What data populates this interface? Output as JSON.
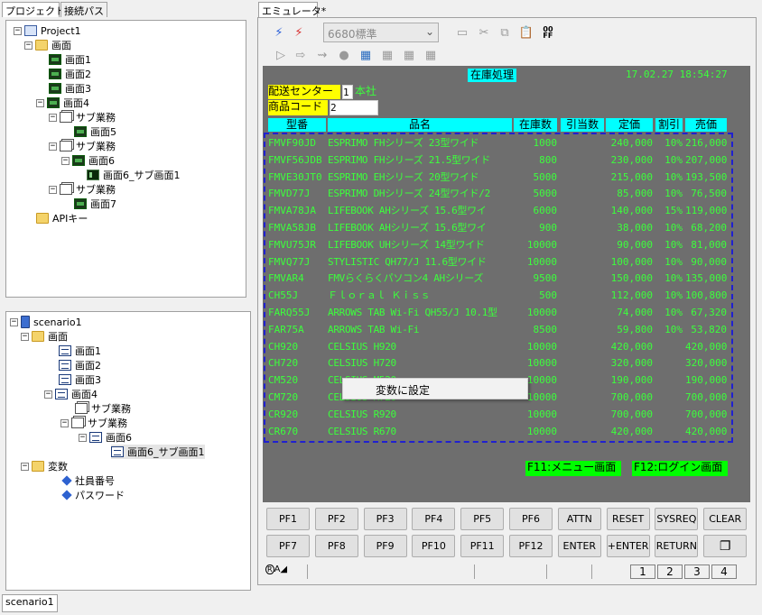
{
  "left_tabs": [
    "プロジェクト",
    "接続パス"
  ],
  "project_tree": [
    {
      "label": "Project1",
      "icon": "project-icon",
      "exp": "−"
    },
    {
      "label": "画面",
      "icon": "folder-icon",
      "exp": "−"
    },
    {
      "label": "画面1",
      "icon": "screen-icon",
      "exp": ""
    },
    {
      "label": "画面2",
      "icon": "screen-icon",
      "exp": ""
    },
    {
      "label": "画面3",
      "icon": "screen-icon",
      "exp": ""
    },
    {
      "label": "画面4",
      "icon": "screen-icon",
      "exp": "−"
    },
    {
      "label": "サブ業務",
      "icon": "sub-business-icon",
      "exp": "−"
    },
    {
      "label": "画面5",
      "icon": "screen-icon",
      "exp": ""
    },
    {
      "label": "サブ業務",
      "icon": "sub-business-icon",
      "exp": "−"
    },
    {
      "label": "画面6",
      "icon": "screen-icon",
      "exp": "−"
    },
    {
      "label": "画面6_サブ画面1",
      "icon": "sub-screen-icon",
      "exp": ""
    },
    {
      "label": "サブ業務",
      "icon": "sub-business-icon",
      "exp": "−"
    },
    {
      "label": "画面7",
      "icon": "screen-icon",
      "exp": ""
    },
    {
      "label": "APIキー",
      "icon": "folder-icon",
      "exp": ""
    }
  ],
  "scenario_tree": [
    {
      "label": "scenario1",
      "icon": "scenario-icon",
      "exp": "−"
    },
    {
      "label": "画面",
      "icon": "folder-icon",
      "exp": "−"
    },
    {
      "label": "画面1",
      "icon": "document-icon",
      "exp": ""
    },
    {
      "label": "画面2",
      "icon": "document-icon",
      "exp": ""
    },
    {
      "label": "画面3",
      "icon": "document-icon",
      "exp": ""
    },
    {
      "label": "画面4",
      "icon": "document-icon",
      "exp": "−"
    },
    {
      "label": "サブ業務",
      "icon": "sub-business-icon",
      "exp": ""
    },
    {
      "label": "サブ業務",
      "icon": "sub-business-icon",
      "exp": "−"
    },
    {
      "label": "画面6",
      "icon": "document-icon",
      "exp": "−"
    },
    {
      "label": "画面6_サブ画面1",
      "icon": "document-icon",
      "exp": ""
    },
    {
      "label": "変数",
      "icon": "folder-icon",
      "exp": "−"
    },
    {
      "label": "社員番号",
      "icon": "variable-icon",
      "exp": ""
    },
    {
      "label": "パスワード",
      "icon": "variable-icon",
      "exp": ""
    }
  ],
  "bottom_tab": "scenario1",
  "emulator_tab": "エミュレータ*",
  "toolbar": {
    "model_select": "6680標準"
  },
  "screen": {
    "title": "在庫処理",
    "datetime": "17.02.27 18:54:27",
    "center_label": "配送センター",
    "center_code": "1",
    "center_name": "本社",
    "product_code_label": "商品コード",
    "product_code_value": "2",
    "columns": [
      "型番",
      "品名",
      "在庫数",
      "引当数",
      "定価",
      "割引",
      "売価"
    ],
    "rows": [
      [
        "FMVF90JD",
        "ESPRIMO FHシリーズ 23型ワイド",
        "1000",
        "",
        "240,000",
        "10%",
        "216,000"
      ],
      [
        "FMVF56JDB",
        "ESPRIMO FHシリーズ 21.5型ワイド",
        "800",
        "",
        "230,000",
        "10%",
        "207,000"
      ],
      [
        "FMVE30JT0",
        "ESPRIMO EHシリーズ 20型ワイド",
        "5000",
        "",
        "215,000",
        "10%",
        "193,500"
      ],
      [
        "FMVD77J",
        "ESPRIMO DHシリーズ 24型ワイド/2",
        "5000",
        "",
        "85,000",
        "10%",
        "76,500"
      ],
      [
        "FMVA78JA",
        "LIFEBOOK AHシリーズ 15.6型ワイ",
        "6000",
        "",
        "140,000",
        "15%",
        "119,000"
      ],
      [
        "FMVA58JB",
        "LIFEBOOK AHシリーズ 15.6型ワイ",
        "900",
        "",
        "38,000",
        "10%",
        "68,200"
      ],
      [
        "FMVU75JR",
        "LIFEBOOK UHシリーズ 14型ワイド",
        "10000",
        "",
        "90,000",
        "10%",
        "81,000"
      ],
      [
        "FMVQ77J",
        "STYLISTIC QH77/J 11.6型ワイド",
        "10000",
        "",
        "100,000",
        "10%",
        "90,000"
      ],
      [
        "FMVAR4",
        "FMVらくらくパソコン4 AHシリーズ",
        "9500",
        "",
        "150,000",
        "10%",
        "135,000"
      ],
      [
        "CH55J",
        "Ｆｌｏｒａｌ Ｋｉｓｓ",
        "500",
        "",
        "112,000",
        "10%",
        "100,800"
      ],
      [
        "FARQ55J",
        "ARROWS TAB Wi-Fi QH55/J 10.1型",
        "10000",
        "",
        "74,000",
        "10%",
        "67,320"
      ],
      [
        "FAR75A",
        "ARROWS TAB Wi-Fi",
        "8500",
        "",
        "59,800",
        "10%",
        "53,820"
      ],
      [
        "CH920",
        "CELSIUS H920",
        "10000",
        "",
        "420,000",
        "",
        "420,000"
      ],
      [
        "CH720",
        "CELSIUS H720",
        "10000",
        "",
        "320,000",
        "",
        "320,000"
      ],
      [
        "CM520",
        "CELSIUS M520",
        "10000",
        "",
        "190,000",
        "",
        "190,000"
      ],
      [
        "CM720",
        "CELSIUS M720",
        "10000",
        "",
        "700,000",
        "",
        "700,000"
      ],
      [
        "CR920",
        "CELSIUS R920",
        "10000",
        "",
        "700,000",
        "",
        "700,000"
      ],
      [
        "CR670",
        "CELSIUS R670",
        "10000",
        "",
        "420,000",
        "",
        "420,000"
      ]
    ],
    "f11": "F11:メニュー画面",
    "f12": "F12:ログイン画面"
  },
  "context_menu": {
    "item": "変数に設定"
  },
  "pf_row1": [
    "PF1",
    "PF2",
    "PF3",
    "PF4",
    "PF5",
    "PF6",
    "ATTN",
    "RESET",
    "SYSREQ",
    "CLEAR"
  ],
  "pf_row2": [
    "PF7",
    "PF8",
    "PF9",
    "PF10",
    "PF11",
    "PF12",
    "ENTER",
    "+ENTER",
    "RETURN",
    ""
  ],
  "status": {
    "mode": "R",
    "indicator": "A",
    "pages": [
      "1",
      "2",
      "3",
      "4"
    ]
  },
  "colors": {
    "emulator_bg": "#6e6e6e",
    "field_text": "#3cff3c",
    "header_bg": "#00ffff",
    "label_bg": "#ffff00",
    "fkey_bg": "#00ff00"
  }
}
